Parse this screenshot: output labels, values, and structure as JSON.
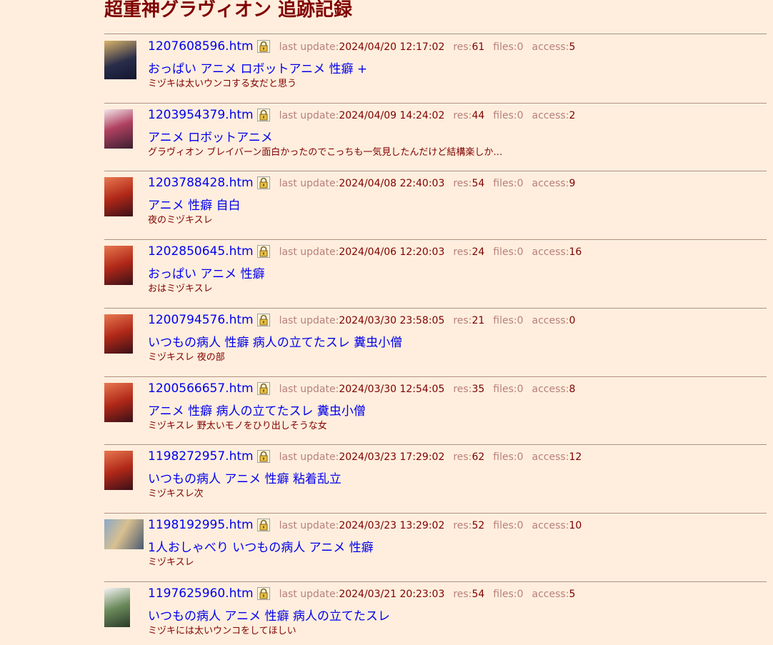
{
  "page": {
    "title": "超重神グラヴィオン 追跡記録"
  },
  "labels": {
    "last_update": "last update:",
    "res": "res:",
    "files": "files:",
    "access": "access:"
  },
  "entries": [
    {
      "file": "1207608596.htm",
      "updated": "2024/04/20 12:17:02",
      "res": "61",
      "files": "0",
      "access": "5",
      "tags": "おっぱい アニメ ロボットアニメ 性癖 +",
      "desc": "ミヅキは太いウンコする女だと思う"
    },
    {
      "file": "1203954379.htm",
      "updated": "2024/04/09 14:24:02",
      "res": "44",
      "files": "0",
      "access": "2",
      "tags": "アニメ ロボットアニメ",
      "desc": "グラヴィオン ブレイバーン面白かったのでこっちも一気見したんだけど結構楽しか…"
    },
    {
      "file": "1203788428.htm",
      "updated": "2024/04/08 22:40:03",
      "res": "54",
      "files": "0",
      "access": "9",
      "tags": "アニメ 性癖 自白",
      "desc": "夜のミヅキスレ"
    },
    {
      "file": "1202850645.htm",
      "updated": "2024/04/06 12:20:03",
      "res": "24",
      "files": "0",
      "access": "16",
      "tags": "おっぱい アニメ 性癖",
      "desc": "おはミヅキスレ"
    },
    {
      "file": "1200794576.htm",
      "updated": "2024/03/30 23:58:05",
      "res": "21",
      "files": "0",
      "access": "0",
      "tags": "いつもの病人 性癖 病人の立てたスレ 糞虫小僧",
      "desc": "ミヅキスレ 夜の部"
    },
    {
      "file": "1200566657.htm",
      "updated": "2024/03/30 12:54:05",
      "res": "35",
      "files": "0",
      "access": "8",
      "tags": "アニメ 性癖 病人の立てたスレ 糞虫小僧",
      "desc": "ミヅキスレ 野太いモノをひり出しそうな女"
    },
    {
      "file": "1198272957.htm",
      "updated": "2024/03/23 17:29:02",
      "res": "62",
      "files": "0",
      "access": "12",
      "tags": "いつもの病人 アニメ 性癖 粘着乱立",
      "desc": "ミヅキスレ次"
    },
    {
      "file": "1198192995.htm",
      "updated": "2024/03/23 13:29:02",
      "res": "52",
      "files": "0",
      "access": "10",
      "tags": "1人おしゃべり いつもの病人 アニメ 性癖",
      "desc": "ミヅキスレ"
    },
    {
      "file": "1197625960.htm",
      "updated": "2024/03/21 20:23:03",
      "res": "54",
      "files": "0",
      "access": "5",
      "tags": "いつもの病人 アニメ 性癖 病人の立てたスレ",
      "desc": "ミヅキには太いウンコをしてほしい"
    }
  ]
}
